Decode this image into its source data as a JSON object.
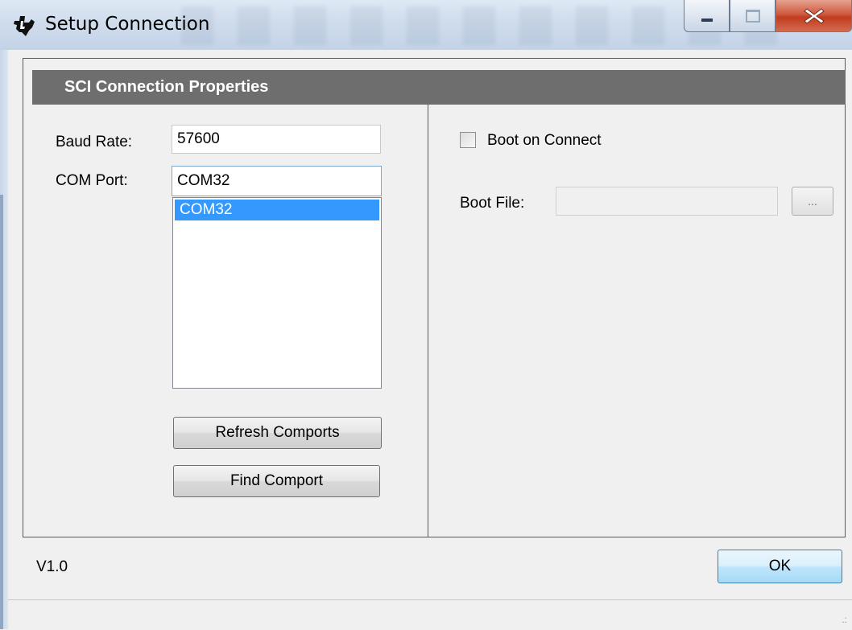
{
  "window": {
    "title": "Setup Connection",
    "controls": {
      "minimize": "minimize",
      "maximize": "maximize",
      "close": "close"
    }
  },
  "panel": {
    "header": "SCI Connection Properties",
    "baud_rate": {
      "label": "Baud Rate:",
      "value": "57600"
    },
    "com_port": {
      "label": "COM Port:",
      "value": "COM32",
      "options": [
        "COM32"
      ],
      "selected": "COM32"
    },
    "buttons": {
      "refresh": "Refresh Comports",
      "find": "Find Comport"
    },
    "boot_on_connect": {
      "label": "Boot on Connect",
      "checked": false
    },
    "boot_file": {
      "label": "Boot File:",
      "value": "",
      "browse": "..."
    }
  },
  "footer": {
    "version": "V1.0",
    "ok": "OK"
  },
  "colors": {
    "header_bg": "#6e6e6e",
    "selection": "#3399ff",
    "close_button": "#c03c1f"
  }
}
